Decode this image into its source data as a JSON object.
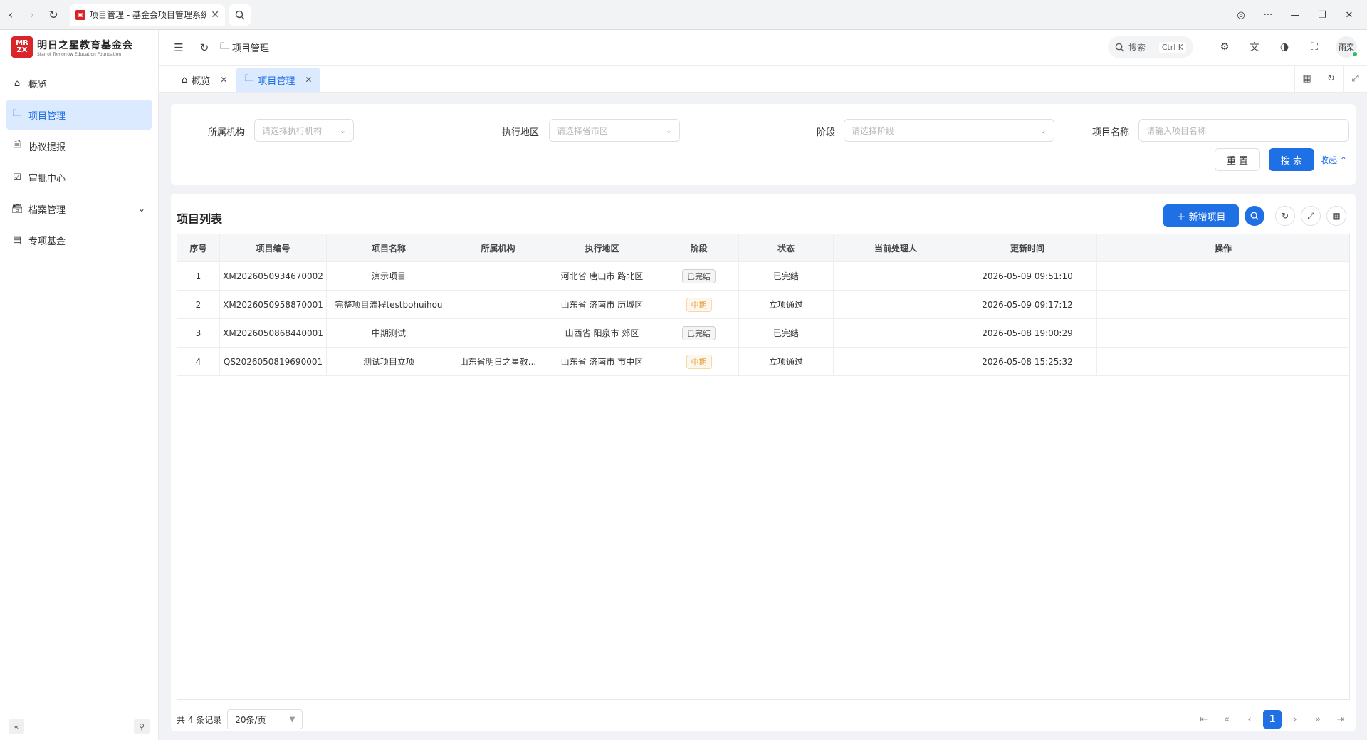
{
  "browser": {
    "tab_title": "项目管理 - 基金会项目管理系统"
  },
  "sidebar": {
    "logo_mark": "MR ZX",
    "org_name": "明日之星教育基金会",
    "org_sub": "Star of Tomorrow Education Foundation",
    "items": [
      {
        "label": "概览"
      },
      {
        "label": "项目管理"
      },
      {
        "label": "协议提报"
      },
      {
        "label": "审批中心"
      },
      {
        "label": "档案管理"
      },
      {
        "label": "专项基金"
      }
    ]
  },
  "header": {
    "breadcrumb": "项目管理",
    "search_label": "搜索",
    "search_shortcut": "Ctrl K",
    "user_name": "雨栾"
  },
  "tabs": [
    {
      "label": "概览"
    },
    {
      "label": "项目管理"
    }
  ],
  "filters": {
    "org_label": "所属机构",
    "org_placeholder": "请选择执行机构",
    "area_label": "执行地区",
    "area_placeholder": "请选择省市区",
    "stage_label": "阶段",
    "stage_placeholder": "请选择阶段",
    "name_label": "项目名称",
    "name_placeholder": "请输入项目名称",
    "reset_label": "重 置",
    "search_label": "搜 索",
    "collapse_label": "收起"
  },
  "table": {
    "title": "项目列表",
    "add_label": "新增项目",
    "columns": [
      "序号",
      "项目编号",
      "项目名称",
      "所属机构",
      "执行地区",
      "阶段",
      "状态",
      "当前处理人",
      "更新时间",
      "操作"
    ],
    "rows": [
      {
        "seq": "1",
        "code": "XM2026050934670002",
        "name": "演示项目",
        "org": "",
        "area": "河北省 唐山市 路北区",
        "stage": "已完结",
        "stage_type": "done",
        "status": "已完结",
        "handler": "",
        "time": "2026-05-09 09:51:10"
      },
      {
        "seq": "2",
        "code": "XM2026050958870001",
        "name": "完整项目流程testbohuihou",
        "org": "",
        "area": "山东省 济南市 历城区",
        "stage": "中期",
        "stage_type": "mid",
        "status": "立项通过",
        "handler": "",
        "time": "2026-05-09 09:17:12"
      },
      {
        "seq": "3",
        "code": "XM2026050868440001",
        "name": "中期测试",
        "org": "",
        "area": "山西省 阳泉市 郊区",
        "stage": "已完结",
        "stage_type": "done",
        "status": "已完结",
        "handler": "",
        "time": "2026-05-08 19:00:29"
      },
      {
        "seq": "4",
        "code": "QS2026050819690001",
        "name": "测试项目立项",
        "org": "山东省明日之星教...",
        "area": "山东省 济南市 市中区",
        "stage": "中期",
        "stage_type": "mid",
        "status": "立项通过",
        "handler": "",
        "time": "2026-05-08 15:25:32"
      }
    ]
  },
  "pagination": {
    "total_text": "共 4 条记录",
    "page_size": "20条/页",
    "current_page": "1"
  }
}
